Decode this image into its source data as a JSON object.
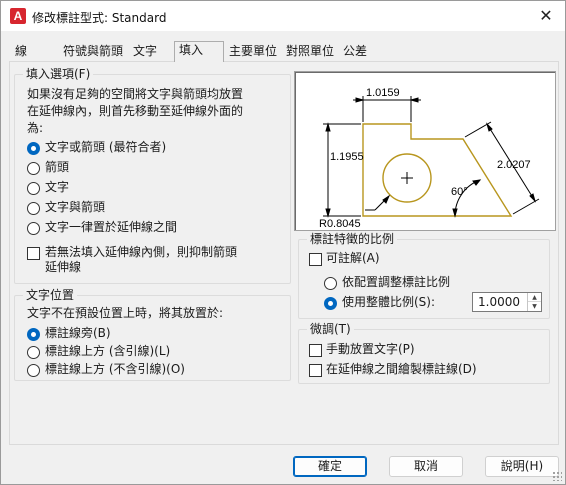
{
  "window": {
    "title": "修改標註型式: Standard",
    "app_icon": "A",
    "close_glyph": "✕"
  },
  "tabs": [
    {
      "label": "線"
    },
    {
      "label": "符號與箭頭"
    },
    {
      "label": "文字"
    },
    {
      "label": "填入"
    },
    {
      "label": "主要單位"
    },
    {
      "label": "對照單位"
    },
    {
      "label": "公差"
    }
  ],
  "active_tab": "填入",
  "fit_options": {
    "title": "填入選項(F)",
    "description": [
      "如果沒有足夠的空間將文字與箭頭均放置",
      "在延伸線內，則首先移動至延伸線外面的",
      "為:"
    ],
    "radios": [
      {
        "label": "文字或箭頭 (最符合者)",
        "checked": true
      },
      {
        "label": "箭頭",
        "checked": false
      },
      {
        "label": "文字",
        "checked": false
      },
      {
        "label": "文字與箭頭",
        "checked": false
      },
      {
        "label": "文字一律置於延伸線之間",
        "checked": false
      }
    ],
    "suppress_checkbox": {
      "label_line1": "若無法填入延伸線內側，則抑制箭頭",
      "label_line2": "延伸線",
      "checked": false
    }
  },
  "text_placement": {
    "title": "文字位置",
    "description": "文字不在預設位置上時，將其放置於:",
    "radios": [
      {
        "label": "標註線旁(B)",
        "checked": true
      },
      {
        "label": "標註線上方 (含引線)(L)",
        "checked": false
      },
      {
        "label": "標註線上方 (不含引線)(O)",
        "checked": false
      }
    ]
  },
  "preview": {
    "dim_top": "1.0159",
    "dim_left": "1.1955",
    "dim_right": "2.0207",
    "dim_angle": "60°",
    "dim_radius": "R0.8045",
    "colors": {
      "outline": "#b8961e",
      "dimension": "#000000"
    }
  },
  "scale_group": {
    "title": "標註特徵的比例",
    "annotative": {
      "label": "可註解(A)",
      "checked": false
    },
    "radios": [
      {
        "label": "依配置調整標註比例",
        "checked": false
      },
      {
        "label": "使用整體比例(S):",
        "checked": true
      }
    ],
    "overall_scale": "1.0000"
  },
  "fine_tuning": {
    "title": "微調(T)",
    "checkboxes": [
      {
        "label": "手動放置文字(P)",
        "checked": false
      },
      {
        "label": "在延伸線之間繪製標註線(D)",
        "checked": false
      }
    ]
  },
  "buttons": {
    "ok": "確定",
    "cancel": "取消",
    "help": "說明(H)"
  },
  "colors": {
    "accent": "#0067c0",
    "autocad_red": "#d7262f"
  }
}
